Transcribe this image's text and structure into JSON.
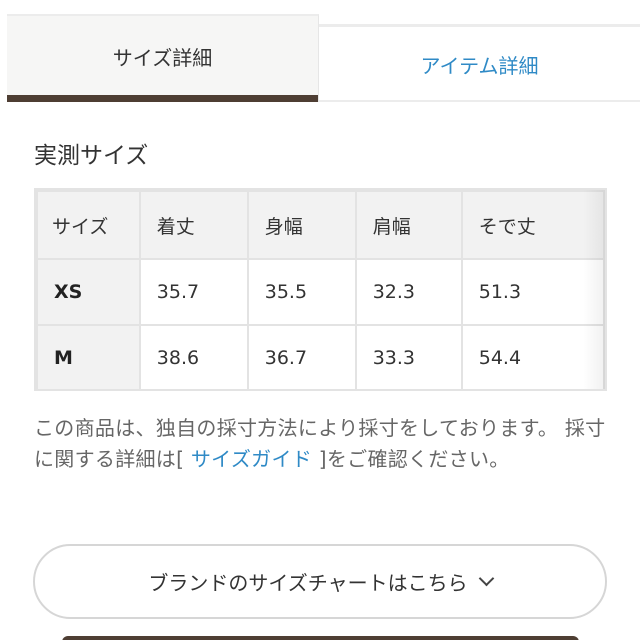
{
  "tabs": {
    "active": "サイズ詳細",
    "inactive": "アイテム詳細"
  },
  "section_title": "実測サイズ",
  "size_table": {
    "headers": [
      "サイズ",
      "着丈",
      "身幅",
      "肩幅",
      "そで丈"
    ],
    "rows": [
      {
        "size": "XS",
        "values": [
          "35.7",
          "35.5",
          "32.3",
          "51.3"
        ]
      },
      {
        "size": "M",
        "values": [
          "38.6",
          "36.7",
          "33.3",
          "54.4"
        ]
      }
    ]
  },
  "note": {
    "text_before": "この商品は、独自の採寸方法により採寸をしております。 採寸に関する詳細は[ ",
    "link_label": "サイズガイド",
    "text_after": " ]をご確認ください。"
  },
  "brand_chart_button": {
    "label": "ブランドのサイズチャートはこちら",
    "icon": "chevron-down-icon"
  },
  "colors": {
    "accent_brown": "#4e3e33",
    "link_blue": "#2f8ac6"
  }
}
